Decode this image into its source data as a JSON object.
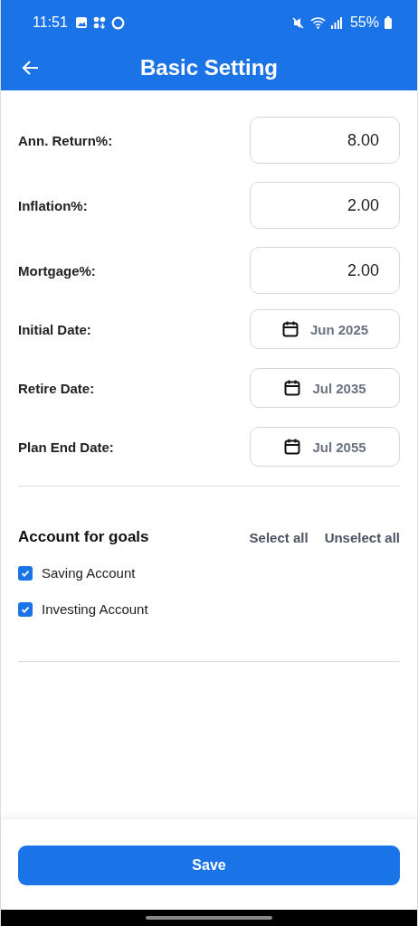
{
  "status_bar": {
    "time": "11:51",
    "battery": "55%"
  },
  "app_bar": {
    "title": "Basic Setting"
  },
  "fields": [
    {
      "kind": "number",
      "label": "Ann. Return%:",
      "value": "8.00"
    },
    {
      "kind": "number",
      "label": "Inflation%:",
      "value": "2.00"
    },
    {
      "kind": "number",
      "label": "Mortgage%:",
      "value": "2.00"
    },
    {
      "kind": "date",
      "label": "Initial Date:",
      "value": "Jun 2025"
    },
    {
      "kind": "date",
      "label": "Retire Date:",
      "value": "Jul 2035"
    },
    {
      "kind": "date",
      "label": "Plan End Date:",
      "value": "Jul 2055"
    }
  ],
  "accounts": {
    "title": "Account for goals",
    "select_all": "Select all",
    "unselect_all": "Unselect all",
    "items": [
      {
        "label": "Saving Account",
        "checked": true
      },
      {
        "label": "Investing Account",
        "checked": true
      }
    ]
  },
  "save_button": "Save"
}
